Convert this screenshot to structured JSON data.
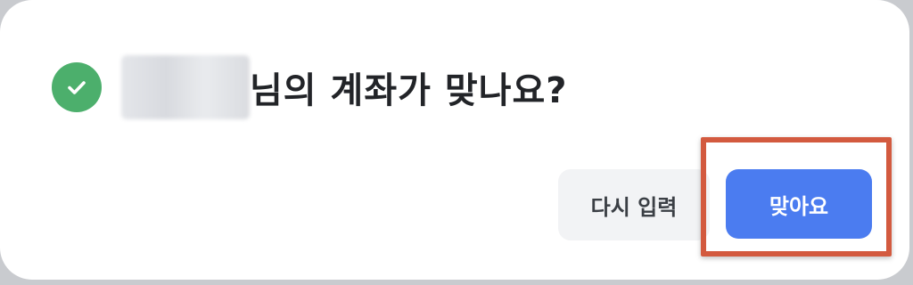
{
  "dialog": {
    "title": "님의 계좌가 맞나요?",
    "icon": "check-circle-icon",
    "name_masked": true
  },
  "buttons": {
    "retry_label": "다시 입력",
    "confirm_label": "맞아요"
  },
  "annotation": {
    "highlight_target": "confirm-button"
  },
  "colors": {
    "success": "#4caf6c",
    "primary": "#4b7cf0",
    "secondary_bg": "#f2f3f5",
    "highlight": "#d35a3f"
  }
}
